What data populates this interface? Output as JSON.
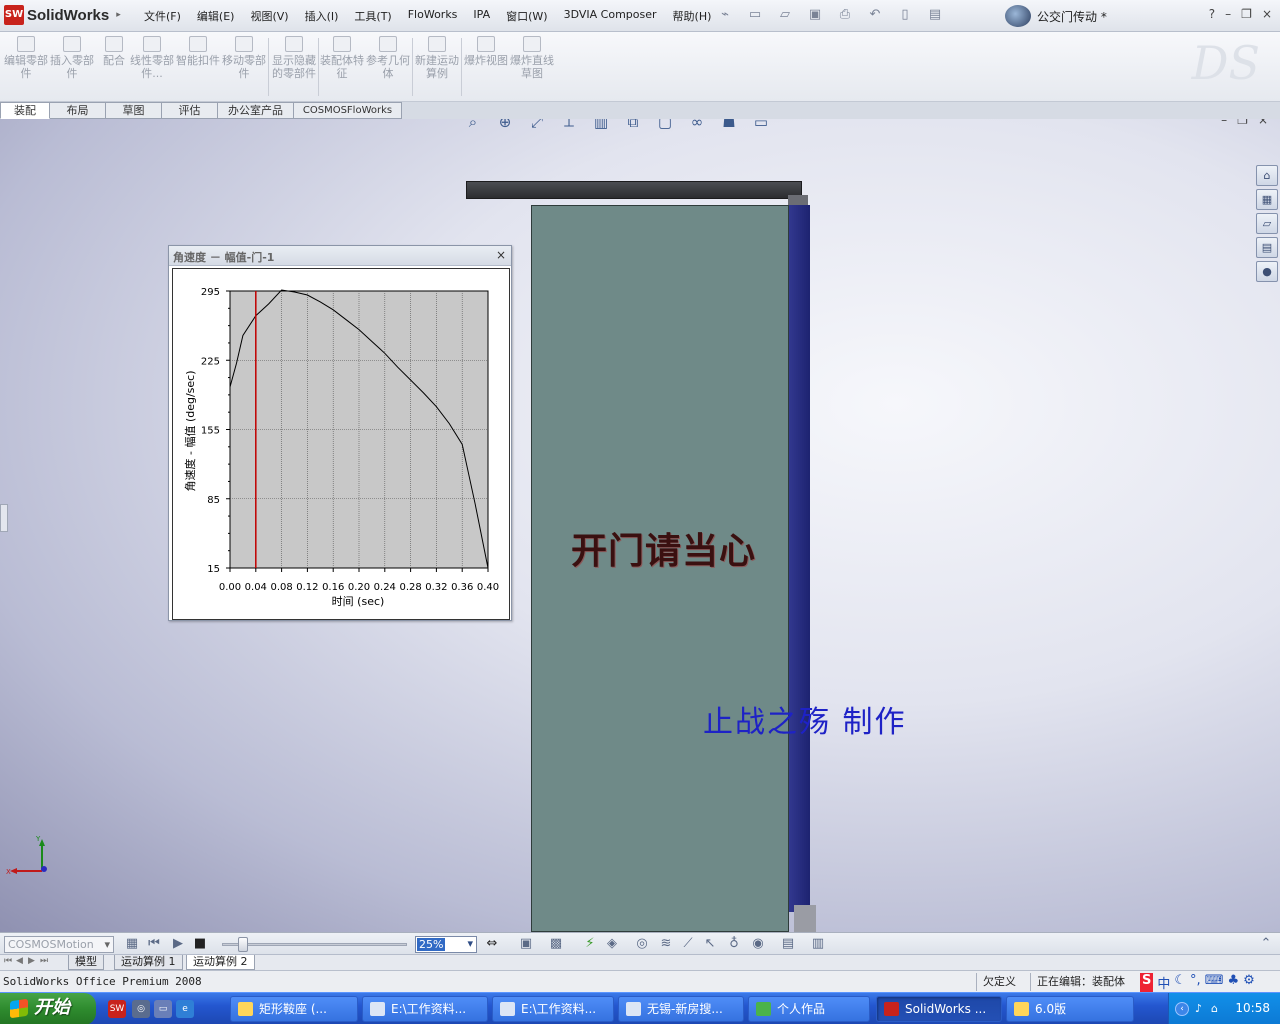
{
  "app": {
    "logo_badge": "SW",
    "logo_text": "SolidWorks",
    "document_title": "公交门传动 *"
  },
  "menu": [
    "文件(F)",
    "编辑(E)",
    "视图(V)",
    "插入(I)",
    "工具(T)",
    "FloWorks",
    "IPA",
    "窗口(W)",
    "3DVIA Composer",
    "帮助(H)"
  ],
  "window_controls": {
    "help": "?",
    "minimize": "–",
    "restore": "❐",
    "close": "×"
  },
  "command_manager": [
    {
      "label": "编辑零部件",
      "icon": "edit-component-icon"
    },
    {
      "label": "插入零部件",
      "icon": "insert-component-icon"
    },
    {
      "label": "配合",
      "icon": "mate-icon"
    },
    {
      "label": "线性零部件...",
      "icon": "linear-pattern-icon"
    },
    {
      "label": "智能扣件",
      "icon": "smart-fastener-icon"
    },
    {
      "label": "移动零部件",
      "icon": "move-component-icon"
    },
    {
      "label": "显示隐藏的零部件",
      "icon": "show-hidden-icon"
    },
    {
      "label": "装配体特征",
      "icon": "assembly-feature-icon"
    },
    {
      "label": "参考几何体",
      "icon": "reference-geometry-icon"
    },
    {
      "label": "新建运动算例",
      "icon": "new-motion-study-icon"
    },
    {
      "label": "爆炸视图",
      "icon": "exploded-view-icon"
    },
    {
      "label": "爆炸直线草图",
      "icon": "explode-line-sketch-icon"
    }
  ],
  "tabs": [
    "装配体",
    "布局",
    "草图",
    "评估",
    "办公室产品",
    "COSMOSFloWorks"
  ],
  "viewport": {
    "door_sign": "开门请当心",
    "author_text": "止战之殇 制作",
    "triad": {
      "x": "X",
      "y": "Y"
    }
  },
  "chart_window": {
    "title": "角速度 － 幅值-门-1",
    "close": "×"
  },
  "chart_data": {
    "type": "line",
    "title": "",
    "xlabel": "时间 (sec)",
    "ylabel": "角速度 - 幅值 (deg/sec)",
    "xlim": [
      0.0,
      0.4
    ],
    "ylim": [
      15,
      295
    ],
    "x_ticks": [
      "0.00",
      "0.04",
      "0.08",
      "0.12",
      "0.16",
      "0.20",
      "0.24",
      "0.28",
      "0.32",
      "0.36",
      "0.40"
    ],
    "y_ticks": [
      "295",
      "225",
      "155",
      "85",
      "15"
    ],
    "grid": true,
    "series": [
      {
        "x": [
          0.0,
          0.01,
          0.02,
          0.04,
          0.06,
          0.08,
          0.1,
          0.12,
          0.14,
          0.16,
          0.18,
          0.2,
          0.22,
          0.24,
          0.26,
          0.28,
          0.3,
          0.32,
          0.34,
          0.36,
          0.38,
          0.4
        ],
        "y": [
          198,
          222,
          250,
          270,
          282,
          296,
          294,
          291,
          284,
          276,
          266,
          256,
          244,
          232,
          218,
          205,
          192,
          178,
          161,
          140,
          80,
          15
        ],
        "color": "#000000"
      }
    ],
    "time_marker": {
      "x": 0.04,
      "color": "#c00000"
    },
    "plot_background": "#c8c8c8"
  },
  "motion_manager": {
    "study_type": "COSMOSMotion",
    "zoom": "25%",
    "study_tabs": [
      "模型",
      "运动算例 1",
      "运动算例 2"
    ]
  },
  "status_bar": {
    "product": "SolidWorks Office Premium 2008",
    "state": "欠定义",
    "editing": "正在编辑：装配体",
    "ime": "中"
  },
  "taskbar": {
    "start": "开始",
    "tasks": [
      "矩形鞍座 (...",
      "E:\\工作资料...",
      "E:\\工作资料...",
      "无锡-新房搜...",
      "个人作品",
      "SolidWorks ...",
      "6.0版"
    ],
    "clock": "10:58"
  }
}
